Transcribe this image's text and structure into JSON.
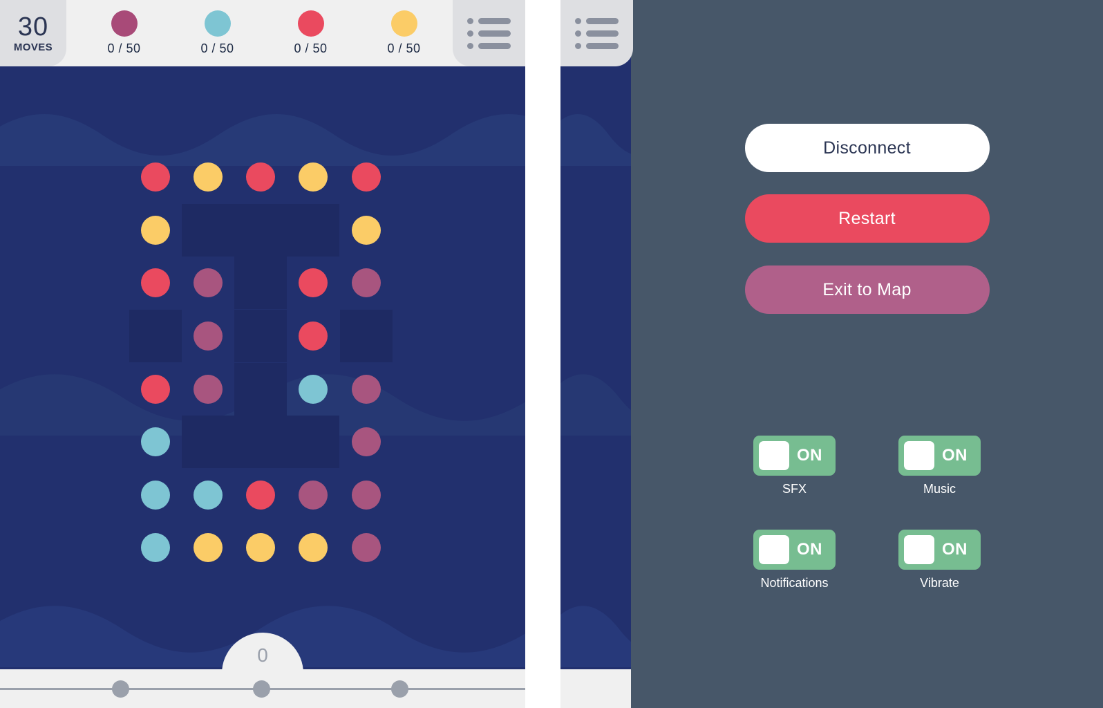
{
  "hud": {
    "moves_count": "30",
    "moves_label": "MOVES",
    "menu_icon": "list-menu-icon",
    "goals": [
      {
        "color": "#a84a78",
        "progress": "0 / 50"
      },
      {
        "color": "#7ec5d3",
        "progress": "0 / 50"
      },
      {
        "color": "#ea4a5f",
        "progress": "0 / 50"
      },
      {
        "color": "#fbcc67",
        "progress": "0 / 50"
      }
    ]
  },
  "board": {
    "background": "#22306e",
    "blocked_color": "#1e2a63",
    "colors": {
      "red": "#ea4a5f",
      "yellow": "#fbcc67",
      "purple": "#a8557f",
      "teal": "#7ec5d3"
    },
    "columns": 5,
    "rows": 8,
    "grid": [
      [
        "red",
        "yellow",
        "red",
        "yellow",
        "red"
      ],
      [
        "yellow",
        null,
        null,
        null,
        "yellow"
      ],
      [
        "red",
        "purple",
        null,
        "red",
        "purple"
      ],
      [
        null,
        "purple",
        null,
        "red",
        null
      ],
      [
        "red",
        "purple",
        null,
        "teal",
        "purple"
      ],
      [
        "teal",
        null,
        null,
        null,
        "purple"
      ],
      [
        "teal",
        "teal",
        "red",
        "purple",
        "purple"
      ],
      [
        "teal",
        "yellow",
        "yellow",
        "yellow",
        "purple"
      ]
    ],
    "blocked_cells": [
      [
        1,
        1
      ],
      [
        1,
        2
      ],
      [
        1,
        3
      ],
      [
        2,
        2
      ],
      [
        3,
        0
      ],
      [
        3,
        2
      ],
      [
        3,
        4
      ],
      [
        4,
        2
      ],
      [
        5,
        1
      ],
      [
        5,
        2
      ],
      [
        5,
        3
      ]
    ]
  },
  "bottom": {
    "counter": "0",
    "handles_count": 3
  },
  "settings": {
    "background": "#475769",
    "buttons": [
      {
        "id": "disconnect",
        "label": "Disconnect",
        "bg": "#ffffff",
        "fg": "#2b3553"
      },
      {
        "id": "restart",
        "label": "Restart",
        "bg": "#ea4a5f",
        "fg": "#ffffff"
      },
      {
        "id": "exit",
        "label": "Exit to Map",
        "bg": "#b0608a",
        "fg": "#ffffff"
      }
    ],
    "toggles": [
      {
        "label": "SFX",
        "state": "ON",
        "on": true
      },
      {
        "label": "Music",
        "state": "ON",
        "on": true
      },
      {
        "label": "Notifications",
        "state": "ON",
        "on": true
      },
      {
        "label": "Vibrate",
        "state": "ON",
        "on": true
      }
    ],
    "toggle_on_color": "#77bd91"
  }
}
